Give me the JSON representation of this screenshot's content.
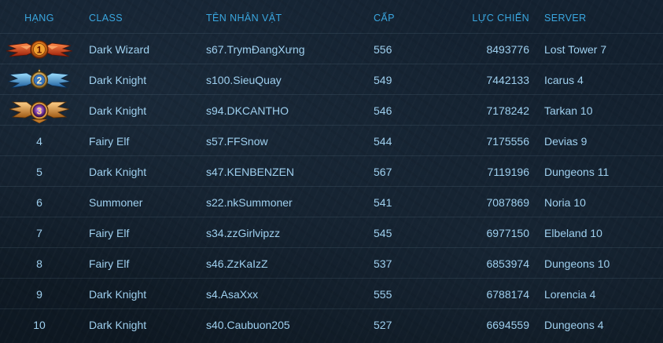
{
  "headers": {
    "rank": "HẠNG",
    "class": "CLASS",
    "name": "TÊN NHÂN VẬT",
    "level": "CẤP",
    "power": "LỰC CHIẾN",
    "server": "SERVER"
  },
  "colors": {
    "header_text": "#3aa7e0",
    "row_text": "#9fd0ef",
    "gold_medal": "#d24a1f",
    "silver_medal": "#3a9fe0",
    "bronze_medal": "#e8922e"
  },
  "rows": [
    {
      "rank": "1",
      "medal": "gold-medal-icon",
      "class": "Dark Wizard",
      "name": "s67.TrymĐangXưng",
      "level": "556",
      "power": "8493776",
      "server": "Lost Tower 7"
    },
    {
      "rank": "2",
      "medal": "silver-medal-icon",
      "class": "Dark Knight",
      "name": "s100.SieuQuay",
      "level": "549",
      "power": "7442133",
      "server": "Icarus 4"
    },
    {
      "rank": "3",
      "medal": "bronze-medal-icon",
      "class": "Dark Knight",
      "name": "s94.DKCANTHO",
      "level": "546",
      "power": "7178242",
      "server": "Tarkan 10"
    },
    {
      "rank": "4",
      "class": "Fairy Elf",
      "name": "s57.FFSnow",
      "level": "544",
      "power": "7175556",
      "server": "Devias 9"
    },
    {
      "rank": "5",
      "class": "Dark Knight",
      "name": "s47.KENBENZEN",
      "level": "567",
      "power": "7119196",
      "server": "Dungeons 11"
    },
    {
      "rank": "6",
      "class": "Summoner",
      "name": "s22.nkSummoner",
      "level": "541",
      "power": "7087869",
      "server": "Noria 10"
    },
    {
      "rank": "7",
      "class": "Fairy Elf",
      "name": "s34.zzGirlvipzz",
      "level": "545",
      "power": "6977150",
      "server": "Elbeland 10"
    },
    {
      "rank": "8",
      "class": "Fairy Elf",
      "name": "s46.ZzKaIzZ",
      "level": "537",
      "power": "6853974",
      "server": "Dungeons 10"
    },
    {
      "rank": "9",
      "class": "Dark Knight",
      "name": "s4.AsaXxx",
      "level": "555",
      "power": "6788174",
      "server": "Lorencia 4"
    },
    {
      "rank": "10",
      "class": "Dark Knight",
      "name": "s40.Caubuon205",
      "level": "527",
      "power": "6694559",
      "server": "Dungeons 4"
    }
  ]
}
